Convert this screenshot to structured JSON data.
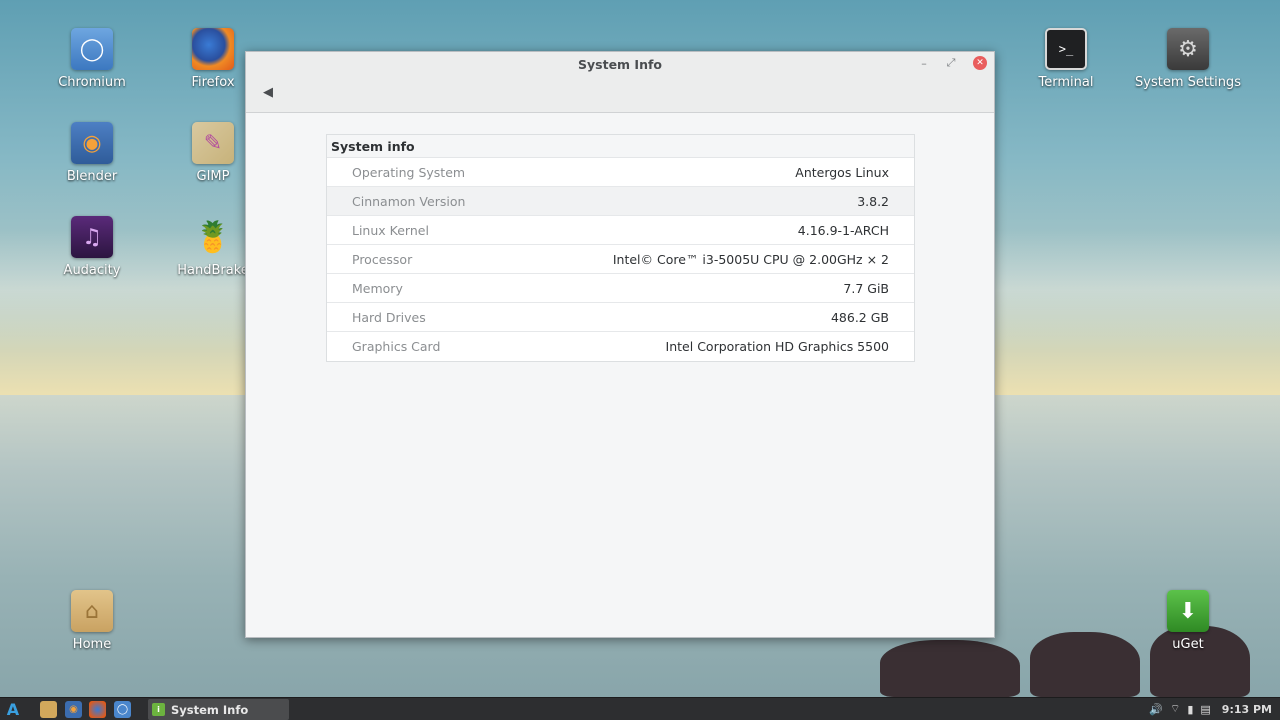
{
  "desktop": {
    "icons": [
      {
        "label": "Chromium"
      },
      {
        "label": "Firefox"
      },
      {
        "label": "Blender"
      },
      {
        "label": "GIMP"
      },
      {
        "label": "Audacity"
      },
      {
        "label": "HandBrake"
      },
      {
        "label": "Terminal"
      },
      {
        "label": "System Settings"
      },
      {
        "label": "Home"
      },
      {
        "label": "uGet"
      }
    ]
  },
  "window": {
    "title": "System Info",
    "controls": {
      "minimize": "–",
      "maximize": "⤢",
      "close": "✕"
    },
    "back_icon": "◀"
  },
  "sysinfo": {
    "heading": "System info",
    "rows": [
      {
        "key": "Operating System",
        "value": "Antergos Linux"
      },
      {
        "key": "Cinnamon Version",
        "value": "3.8.2"
      },
      {
        "key": "Linux Kernel",
        "value": "4.16.9-1-ARCH"
      },
      {
        "key": "Processor",
        "value": "Intel© Core™ i3-5005U CPU @ 2.00GHz × 2"
      },
      {
        "key": "Memory",
        "value": "7.7 GiB"
      },
      {
        "key": "Hard Drives",
        "value": "486.2 GB"
      },
      {
        "key": "Graphics Card",
        "value": "Intel Corporation HD Graphics 5500"
      }
    ]
  },
  "taskbar": {
    "task_label": "System Info",
    "clock": "9:13 PM"
  },
  "colors": {
    "close_button": "#e95d5d",
    "taskbar_bg": "#2d2e30",
    "menu_accent": "#3aa0e0"
  }
}
